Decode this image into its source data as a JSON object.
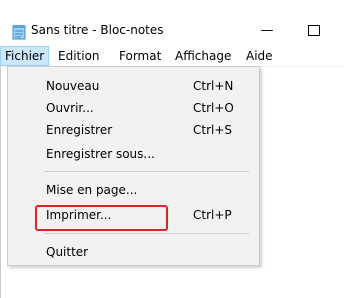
{
  "window": {
    "title": "Sans titre - Bloc-notes",
    "minimize_glyph": "—",
    "icon": "notepad-icon"
  },
  "menubar": {
    "items": [
      {
        "label": "Fichier",
        "active": true
      },
      {
        "label": "Edition"
      },
      {
        "label": "Format"
      },
      {
        "label": "Affichage"
      },
      {
        "label": "Aide"
      }
    ]
  },
  "file_menu": {
    "items": [
      {
        "label": "Nouveau",
        "shortcut": "Ctrl+N"
      },
      {
        "label": "Ouvrir...",
        "shortcut": "Ctrl+O"
      },
      {
        "label": "Enregistrer",
        "shortcut": "Ctrl+S"
      },
      {
        "label": "Enregistrer sous...",
        "shortcut": ""
      },
      {
        "label": "Mise en page...",
        "shortcut": ""
      },
      {
        "label": "Imprimer...",
        "shortcut": "Ctrl+P",
        "highlighted": true
      },
      {
        "label": "Quitter",
        "shortcut": ""
      }
    ]
  },
  "colors": {
    "menu_active_bg": "#cce8ff",
    "dropdown_bg": "#f2f2f2",
    "highlight_border": "#e0242c"
  }
}
